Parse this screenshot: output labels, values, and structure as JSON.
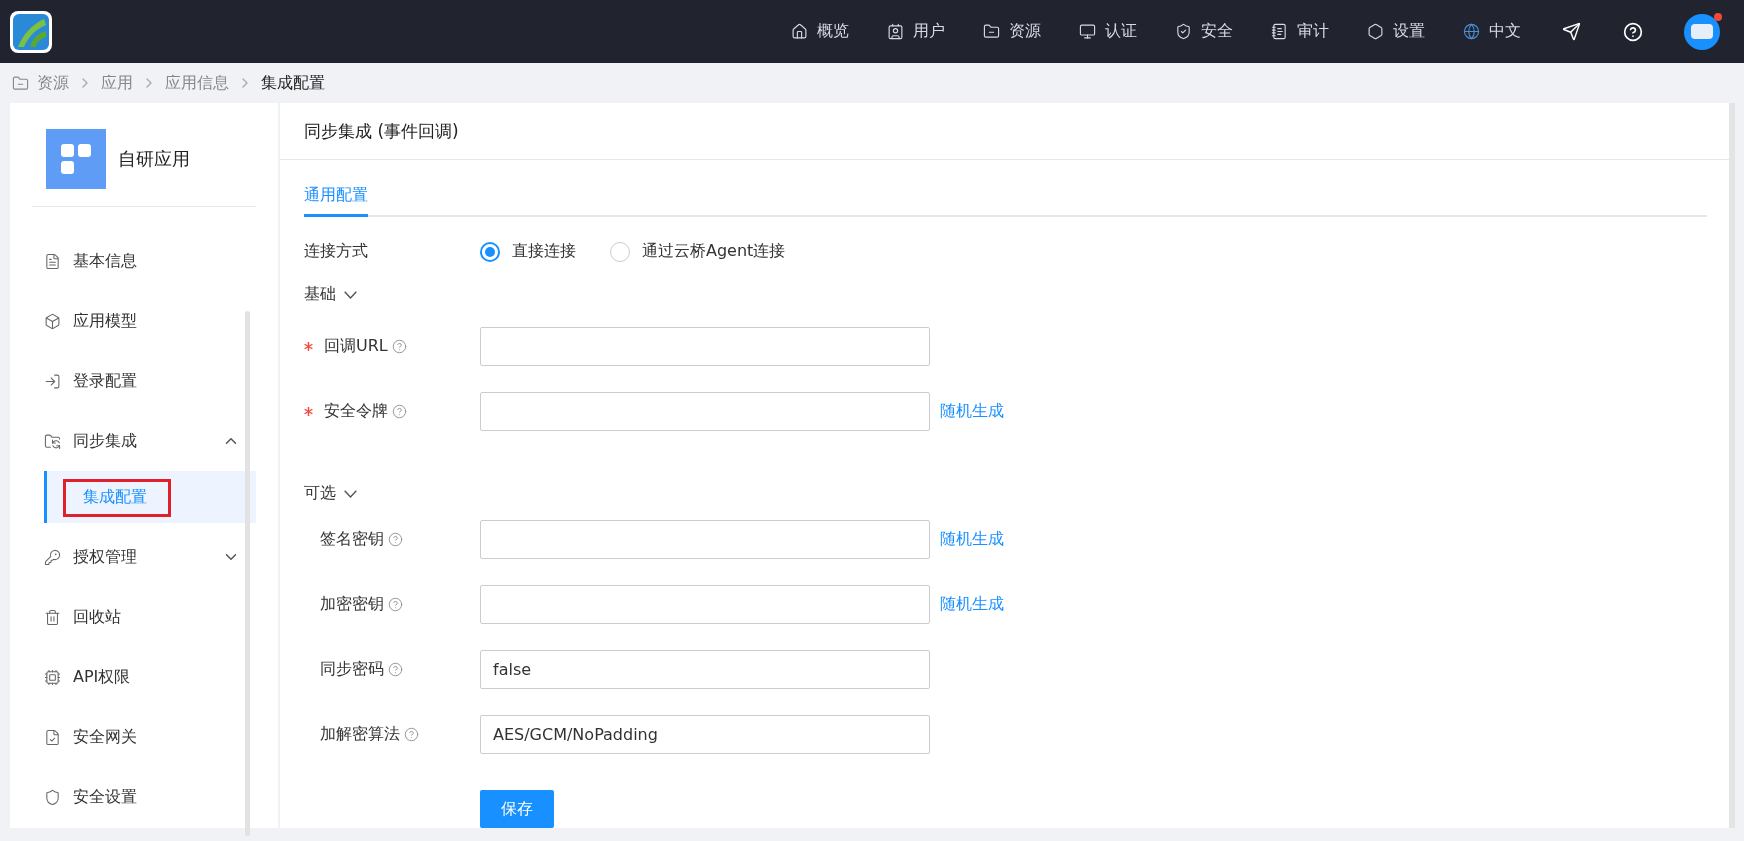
{
  "topbar": {
    "nav": [
      {
        "label": "概览"
      },
      {
        "label": "用户"
      },
      {
        "label": "资源"
      },
      {
        "label": "认证"
      },
      {
        "label": "安全"
      },
      {
        "label": "审计"
      },
      {
        "label": "设置"
      },
      {
        "label": "中文"
      }
    ],
    "notification_dot": true
  },
  "breadcrumb": [
    "资源",
    "应用",
    "应用信息",
    "集成配置"
  ],
  "sidebar": {
    "app_name": "自研应用",
    "items": [
      {
        "label": "基本信息",
        "selected": false
      },
      {
        "label": "应用模型",
        "selected": false
      },
      {
        "label": "登录配置",
        "selected": false
      },
      {
        "label": "同步集成",
        "selected": false,
        "expanded": true,
        "children": [
          {
            "label": "集成配置",
            "selected": true,
            "annotated": true
          }
        ]
      },
      {
        "label": "授权管理",
        "selected": false,
        "expanded": false
      },
      {
        "label": "回收站",
        "selected": false
      },
      {
        "label": "API权限",
        "selected": false
      },
      {
        "label": "安全网关",
        "selected": false
      },
      {
        "label": "安全设置",
        "selected": false
      }
    ]
  },
  "main": {
    "title": "同步集成 (事件回调)",
    "tabs": [
      {
        "label": "通用配置",
        "selected": true
      }
    ],
    "connection": {
      "label": "连接方式",
      "options": [
        {
          "label": "直接连接",
          "selected": true
        },
        {
          "label": "通过云桥Agent连接",
          "selected": false
        }
      ]
    },
    "sections": [
      {
        "title": "基础",
        "expanded": true,
        "fields": [
          {
            "label": "回调URL",
            "required": true
          },
          {
            "label": "安全令牌",
            "required": true,
            "action": "随机生成"
          }
        ]
      },
      {
        "title": "可选",
        "expanded": true,
        "fields": [
          {
            "label": "签名密钥",
            "required": false,
            "action": "随机生成"
          },
          {
            "label": "加密密钥",
            "required": false,
            "action": "随机生成"
          },
          {
            "label": "同步密码",
            "required": false,
            "value": "false"
          },
          {
            "label": "加解密算法",
            "required": false,
            "value": "AES/GCM/NoPadding"
          }
        ]
      }
    ],
    "save_button": "保存"
  }
}
